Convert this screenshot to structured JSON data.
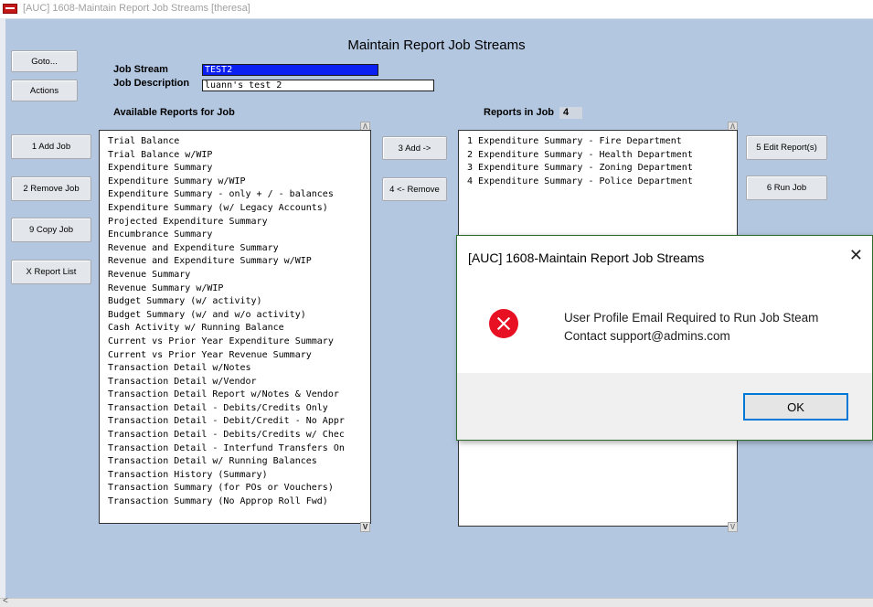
{
  "window": {
    "title": "[AUC] 1608-Maintain Report Job Streams [theresa]"
  },
  "page": {
    "title": "Maintain Report Job Streams"
  },
  "buttons": {
    "goto": "Goto...",
    "actions": "Actions",
    "add_job": "1 Add Job",
    "remove_job": "2 Remove Job",
    "copy_job": "9 Copy Job",
    "report_list": "X Report List",
    "add": "3 Add ->",
    "remove": "4 <- Remove",
    "edit_reports": "5 Edit Report(s)",
    "run_job": "6 Run Job"
  },
  "form": {
    "job_stream_label": "Job Stream",
    "job_stream_value": "TEST2",
    "job_description_label": "Job Description",
    "job_description_value": "luann's test 2"
  },
  "available": {
    "label": "Available Reports for Job",
    "items": [
      "Trial Balance",
      "Trial Balance w/WIP",
      "Expenditure Summary",
      "Expenditure Summary w/WIP",
      "Expenditure Summary - only + / - balances",
      "Expenditure Summary (w/ Legacy Accounts)",
      "Projected Expenditure Summary",
      "Encumbrance Summary",
      "Revenue and Expenditure Summary",
      "Revenue and Expenditure Summary w/WIP",
      "Revenue Summary",
      "Revenue Summary w/WIP",
      "Budget Summary (w/ activity)",
      "Budget Summary (w/ and w/o activity)",
      "Cash Activity w/ Running Balance",
      "Current vs Prior Year Expenditure Summary",
      "Current vs Prior Year Revenue Summary",
      "Transaction Detail w/Notes",
      "Transaction Detail w/Vendor",
      "Transaction Detail Report w/Notes & Vendor",
      "Transaction Detail - Debits/Credits Only",
      "Transaction Detail - Debit/Credit - No Appr",
      "Transaction Detail - Debits/Credits w/ Chec",
      "Transaction Detail - Interfund Transfers On",
      "Transaction Detail w/ Running Balances",
      "Transaction History (Summary)",
      "Transaction Summary (for POs or Vouchers)",
      "Transaction Summary (No Approp Roll Fwd)"
    ]
  },
  "in_job": {
    "label": "Reports in Job",
    "count": "4",
    "items": [
      "1 Expenditure Summary - Fire Department",
      "2 Expenditure Summary - Health Department",
      "3 Expenditure Summary - Zoning Department",
      "4 Expenditure Summary - Police Department"
    ]
  },
  "scroll": {
    "up": "Λ",
    "down": "V",
    "left": "<"
  },
  "dialog": {
    "title": "[AUC] 1608-Maintain Report Job Streams",
    "close": "✕",
    "message_line1": "User Profile Email Required to Run Job Steam",
    "message_line2": "Contact support@admins.com",
    "ok": "OK"
  }
}
